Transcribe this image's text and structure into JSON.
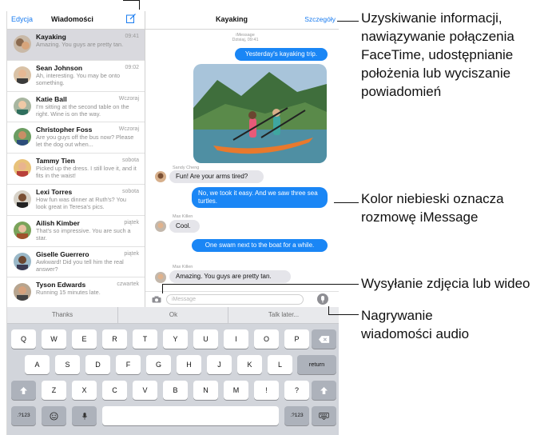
{
  "sidebar": {
    "edit_label": "Edycja",
    "title": "Wiadomości",
    "compose_icon": "compose-icon",
    "conversations": [
      {
        "name": "Kayaking",
        "time": "09:41",
        "preview": "Amazing. You guys are pretty tan."
      },
      {
        "name": "Sean Johnson",
        "time": "09:02",
        "preview": "Ah, interesting. You may be onto something."
      },
      {
        "name": "Katie Ball",
        "time": "Wczoraj",
        "preview": "I'm sitting at the second table on the right. Wine is on the way."
      },
      {
        "name": "Christopher Foss",
        "time": "Wczoraj",
        "preview": "Are you guys off the bus now? Please let the dog out when..."
      },
      {
        "name": "Tammy Tien",
        "time": "sobota",
        "preview": "Picked up the dress. I still love it, and it fits in the waist!"
      },
      {
        "name": "Lexi Torres",
        "time": "sobota",
        "preview": "How fun was dinner at Ruth's? You look great in Teresa's pics."
      },
      {
        "name": "Ailish Kimber",
        "time": "piątek",
        "preview": "That's so impressive. You are such a star."
      },
      {
        "name": "Giselle Guerrero",
        "time": "piątek",
        "preview": "Awkward! Did you tell him the real answer?"
      },
      {
        "name": "Tyson Edwards",
        "time": "czwartek",
        "preview": "Running 15 minutes late."
      }
    ]
  },
  "chat": {
    "title": "Kayaking",
    "details_label": "Szczegóły",
    "meta_service": "iMessage",
    "meta_time": "Dzisiaj, 09:41",
    "messages": [
      {
        "text": "Yesterday's kayaking trip."
      },
      {
        "sender": "Sandy Cheng",
        "text": "Fun! Are your arms tired?"
      },
      {
        "text": "No, we took it easy. And we saw three sea turtles."
      },
      {
        "sender": "Max Killen",
        "text": "Cool."
      },
      {
        "text": "One swam next to the boat for a while."
      },
      {
        "sender": "Max Killen",
        "text": "Amazing. You guys are pretty tan."
      }
    ],
    "input_placeholder": "iMessage",
    "camera_icon": "camera-icon",
    "mic_icon": "microphone-icon"
  },
  "keyboard": {
    "quicktype": [
      "Thanks",
      "Ok",
      "Talk later..."
    ],
    "row1": [
      "Q",
      "W",
      "E",
      "R",
      "T",
      "Y",
      "U",
      "I",
      "O",
      "P"
    ],
    "row2": [
      "A",
      "S",
      "D",
      "F",
      "G",
      "H",
      "J",
      "K",
      "L"
    ],
    "return_label": "return",
    "row3": [
      "Z",
      "X",
      "C",
      "V",
      "B",
      "N",
      "M",
      "!",
      "?"
    ],
    "numbers_label": ".?123"
  },
  "callouts": {
    "info": "Uzyskiwanie informacji, nawiązywanie połączenia FaceTime, udostępnianie położenia lub wyciszanie powiadomień",
    "blue": "Kolor niebieski oznacza rozmowę iMessage",
    "photo": "Wysyłanie zdjęcia lub wideo",
    "audio": "Nagrywanie wiadomości audio"
  },
  "colors": {
    "accent": "#1a7cf0",
    "bubble_blue": "#1a86f5",
    "bubble_gray": "#e5e5ea",
    "keyboard_bg": "#d2d5db"
  }
}
